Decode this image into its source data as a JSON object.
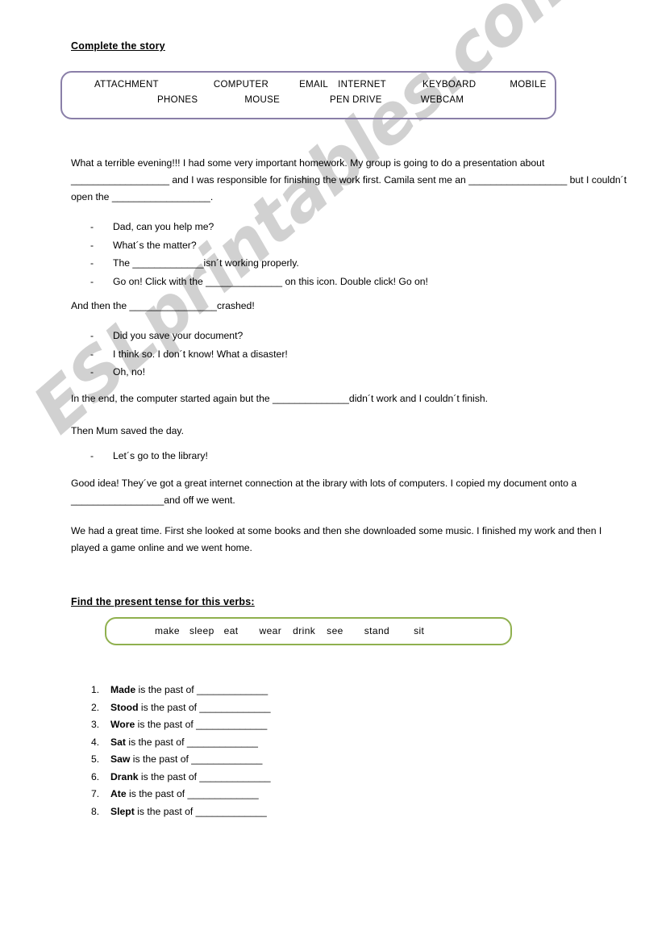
{
  "watermark": {
    "text": "ESLprintables.com",
    "color": "#c9c9c9"
  },
  "colors": {
    "noun_box_border": "#8a7fa8",
    "verb_box_border": "#8fb04e"
  },
  "exercise1": {
    "heading": "Complete the story",
    "word_bank": {
      "row1": [
        "ATTACHMENT",
        "COMPUTER",
        "EMAIL",
        "INTERNET",
        "KEYBOARD",
        "MOBILE"
      ],
      "row2": [
        "PHONES",
        "MOUSE",
        "PEN DRIVE",
        "WEBCAM"
      ]
    },
    "story": {
      "para1_a": "What a terrible evening!!! I had some very important homework. My group is going to do a presentation about ",
      "para1_blank1": "__________________",
      "para1_b": " and I was responsible for finishing the work first. Camila sent me an ",
      "para1_blank2": "__________________",
      "para1_c": " but I couldn´t open the ",
      "para1_blank3": "__________________",
      "para1_d": ".",
      "dialogue1": [
        {
          "text": "Dad, can you help me?"
        },
        {
          "text": "What´s the matter?"
        },
        {
          "prefix": "The ",
          "blank": "_____________",
          "suffix": "isn´t working properly."
        },
        {
          "prefix": "Go on! Click with the ",
          "blank": "______________",
          "suffix": " on this icon. Double click! Go on!"
        }
      ],
      "para2_a": "And then the ",
      "para2_blank": "________________",
      "para2_b": "crashed!",
      "dialogue2": [
        {
          "text": "Did you save your document?"
        },
        {
          "text": "I think so. I don´t know! What a disaster!"
        },
        {
          "text": "Oh, no!"
        }
      ],
      "para3_a": "In the end, the computer started again but the ",
      "para3_blank": "______________",
      "para3_b": "didn´t work and I couldn´t finish.",
      "para4": "Then Mum saved the day.",
      "dialogue3": [
        {
          "text": "Let´s go to the library!"
        }
      ],
      "para5_a": "Good idea! They´ve got a great internet connection at the ibrary with lots of computers. I copied  my document onto a ",
      "para5_blank": "_________________",
      "para5_b": "and off we went.",
      "para6": "We had a great time. First she looked at some books and then she downloaded some music. I finished my work and then I played a game online and we went home."
    }
  },
  "exercise2": {
    "heading": "Find the present tense for this verbs:",
    "word_bank": [
      "make",
      "sleep",
      "eat",
      "wear",
      "drink",
      "see",
      "stand",
      "sit"
    ],
    "items": [
      {
        "num": "1.",
        "verb": "Made",
        "mid": " is the past of ",
        "blank": "_____________"
      },
      {
        "num": "2.",
        "verb": "Stood",
        "mid": " is the past of ",
        "blank": "_____________"
      },
      {
        "num": "3.",
        "verb": "Wore",
        "mid": " is the past of ",
        "blank": "_____________"
      },
      {
        "num": "4.",
        "verb": "Sat",
        "mid": " is the past of ",
        "blank": "_____________"
      },
      {
        "num": "5.",
        "verb": "Saw",
        "mid": " is the past of ",
        "blank": "_____________"
      },
      {
        "num": "6.",
        "verb": "Drank",
        "mid": " is the past of ",
        "blank": "_____________"
      },
      {
        "num": "7.",
        "verb": "Ate",
        "mid": " is the past of ",
        "blank": "_____________"
      },
      {
        "num": "8.",
        "verb": "Slept",
        "mid": " is the past of ",
        "blank": "_____________"
      }
    ]
  }
}
